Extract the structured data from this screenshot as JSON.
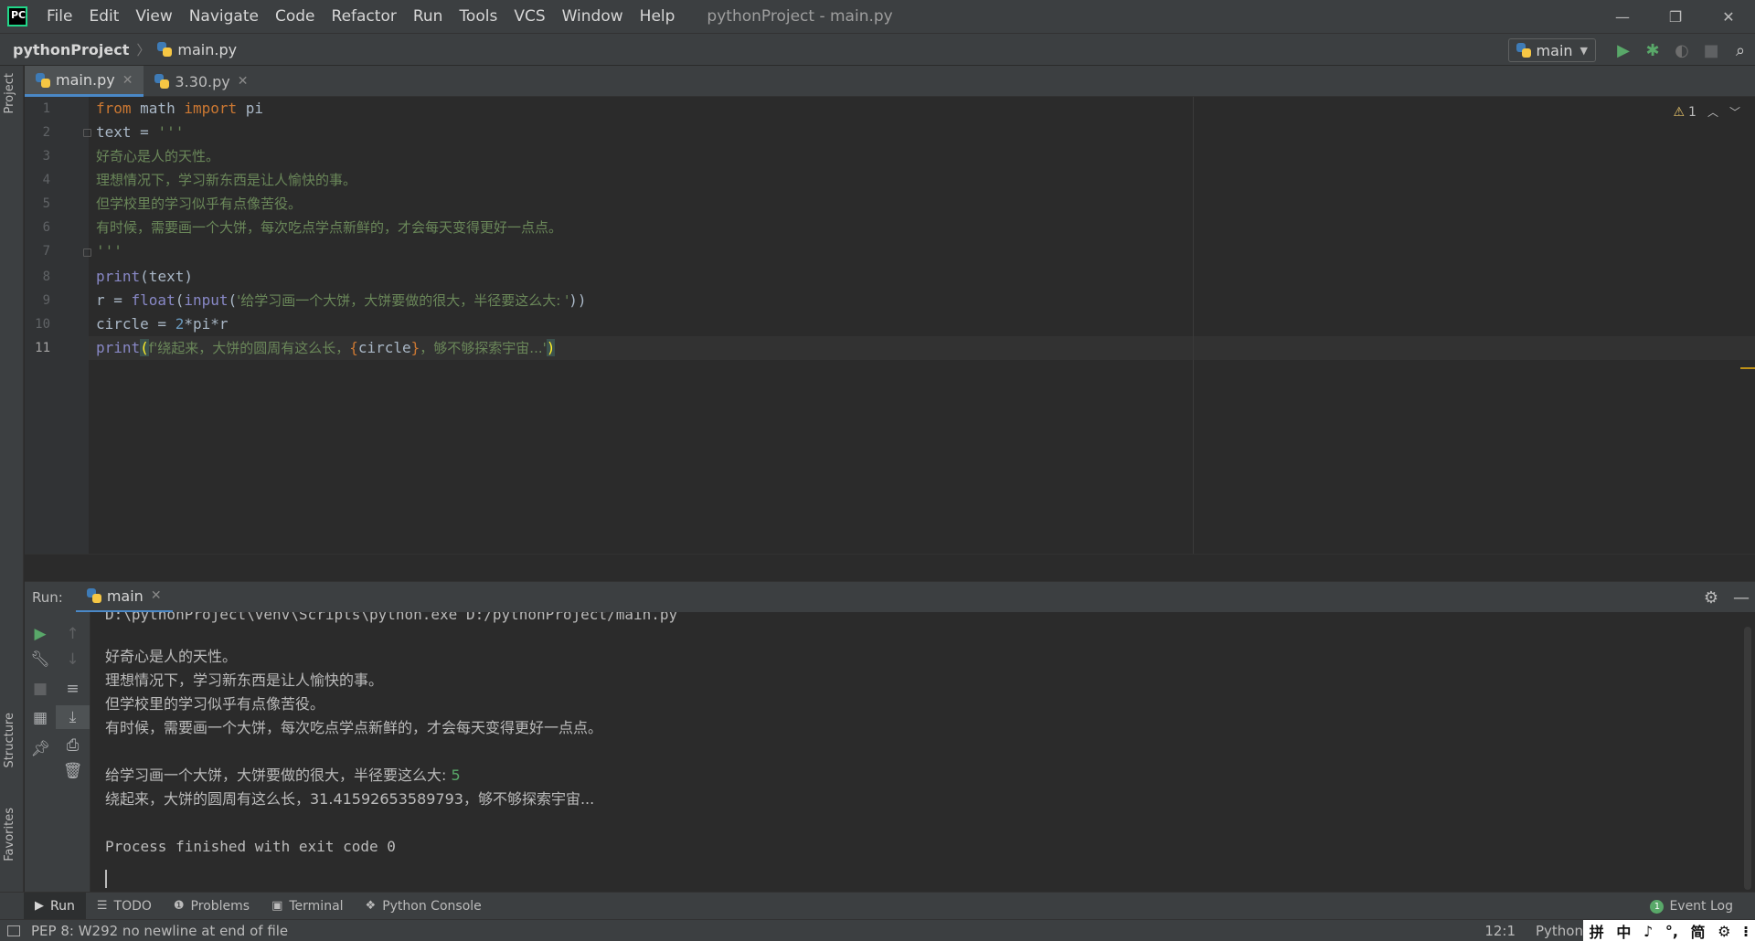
{
  "menu": {
    "items": [
      "File",
      "Edit",
      "View",
      "Navigate",
      "Code",
      "Refactor",
      "Run",
      "Tools",
      "VCS",
      "Window",
      "Help"
    ],
    "window_title": "pythonProject - main.py"
  },
  "window_controls": {
    "minimize": "—",
    "restore": "❐",
    "close": "✕"
  },
  "navbar": {
    "project": "pythonProject",
    "file": "main.py",
    "run_config": "main"
  },
  "left_strip": {
    "project": "Project",
    "structure": "Structure",
    "favorites": "Favorites"
  },
  "editor_tabs": [
    {
      "label": "main.py",
      "active": true
    },
    {
      "label": "3.30.py",
      "active": false
    }
  ],
  "editor": {
    "line_numbers": [
      "1",
      "2",
      "3",
      "4",
      "5",
      "6",
      "7",
      "8",
      "9",
      "10",
      "11"
    ],
    "current_line": "11",
    "inspection_count": "1"
  },
  "code": {
    "l1_from": "from",
    "l1_mid": " math ",
    "l1_import": "import",
    "l1_end": " pi",
    "l2_a": "text = ",
    "l2_str": "'''",
    "l3": "好奇心是人的天性。",
    "l4": "理想情况下，学习新东西是让人愉快的事。",
    "l5": "但学校里的学习似乎有点像苦役。",
    "l6": "有时候，需要画一个大饼，每次吃点学点新鲜的，才会每天变得更好一点点。",
    "l7": "'''",
    "l8_print": "print",
    "l8_rest": "(text)",
    "l9_a": "r = ",
    "l9_float": "float",
    "l9_b": "(",
    "l9_input": "input",
    "l9_c": "(",
    "l9_str": "'给学习画一个大饼，大饼要做的很大，半径要这么大: '",
    "l9_d": "))",
    "l10_a": "circle = ",
    "l10_num": "2",
    "l10_b": "*pi*r",
    "l11_print": "print",
    "l11_open": "(",
    "l11_str1": "f'绕起来，大饼的圆周有这么长，",
    "l11_lb": "{",
    "l11_var": "circle",
    "l11_rb": "}",
    "l11_str2": "，够不够探索宇宙...'",
    "l11_close": ")"
  },
  "run_panel": {
    "label": "Run:",
    "tab": "main"
  },
  "console": {
    "cmd": "D:\\pythonProject\\venv\\Scripts\\python.exe D:/pythonProject/main.py",
    "out1": "好奇心是人的天性。",
    "out2": "理想情况下，学习新东西是让人愉快的事。",
    "out3": "但学校里的学习似乎有点像苦役。",
    "out4": "有时候，需要画一个大饼，每次吃点学点新鲜的，才会每天变得更好一点点。",
    "prompt": "给学习画一个大饼，大饼要做的很大，半径要这么大: ",
    "input_value": "5",
    "result": "绕起来，大饼的圆周有这么长，31.41592653589793，够不够探索宇宙...",
    "exit": "Process finished with exit code 0"
  },
  "bottom_tools": {
    "run": "Run",
    "todo": "TODO",
    "problems": "Problems",
    "terminal": "Terminal",
    "python_console": "Python Console",
    "event_log": "Event Log",
    "event_count": "1"
  },
  "statusbar": {
    "message": "PEP 8: W292 no newline at end of file",
    "position": "12:1",
    "language": "Python",
    "ime": [
      "拼",
      "中",
      "♪",
      "°,",
      "简",
      "⚙",
      "⁝"
    ]
  },
  "colors": {
    "keyword": "#cc7832",
    "string": "#6a8759",
    "number": "#6897bb",
    "builtin": "#8888c6",
    "accent": "#4a88c7",
    "run_green": "#59a869"
  }
}
